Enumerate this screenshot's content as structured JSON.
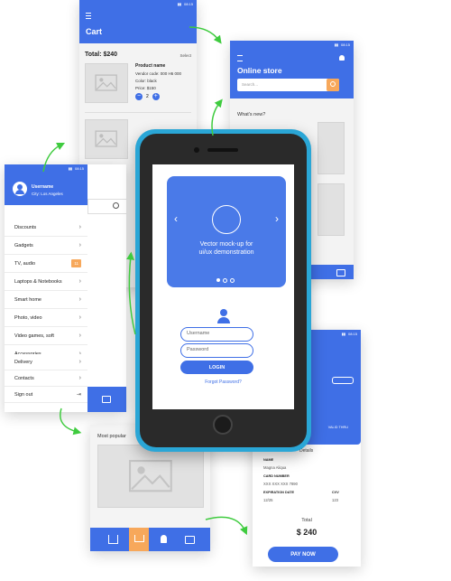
{
  "cart": {
    "title": "Cart",
    "total": "Total: $240",
    "select": "Select",
    "product_name": "Product name",
    "vendor_code": "Vendor code: 000 H6 000",
    "color": "Color: black",
    "price": "Price: $150",
    "qty": "2"
  },
  "store": {
    "title": "Online store",
    "search_placeholder": "Search...",
    "whats_new": "What's new?"
  },
  "menu": {
    "username": "Username",
    "city": "City: Los Angeles",
    "items": [
      "Discounts",
      "Gadgets",
      "TV, audio",
      "Laptops & Notebooks",
      "Smart home",
      "Photo, video",
      "Video games, soft",
      "Accessories"
    ],
    "badge": "11",
    "bottom_items": [
      "Delivery",
      "Contacts",
      "Sign out"
    ]
  },
  "phone": {
    "slide_text_1": "Vector mock-up for",
    "slide_text_2": "ui/ux demonstration",
    "username_placeholder": "Username",
    "password_placeholder": "Password",
    "login": "LOGIN",
    "forgot": "Forgot Password?"
  },
  "popular": {
    "title": "Most popular"
  },
  "checkout": {
    "details": "Details",
    "name_label": "NAME",
    "name_value": "Magna Aliqua",
    "card_label": "CARD NUMBER",
    "card_value": "XXX XXX XXX 7890",
    "exp_label": "EXPIRATION DATE",
    "exp_value": "12/25",
    "cvv_label": "CVV",
    "cvv_value": "123",
    "valid_thru": "VALID THRU",
    "total_label": "Total",
    "total_value": "$ 240",
    "pay_now": "PAY NOW"
  },
  "colors": {
    "accent": "#3f6fe6",
    "phone_body": "#2aa6d6",
    "arrows": "#3fcb3f",
    "badge": "#f7a85b"
  },
  "icons": [
    "menu-icon",
    "bell-icon",
    "search-icon",
    "chevron-left-icon",
    "chevron-right-icon",
    "user-icon",
    "home-icon",
    "cart-icon",
    "bell-icon",
    "card-icon",
    "exit-icon"
  ]
}
